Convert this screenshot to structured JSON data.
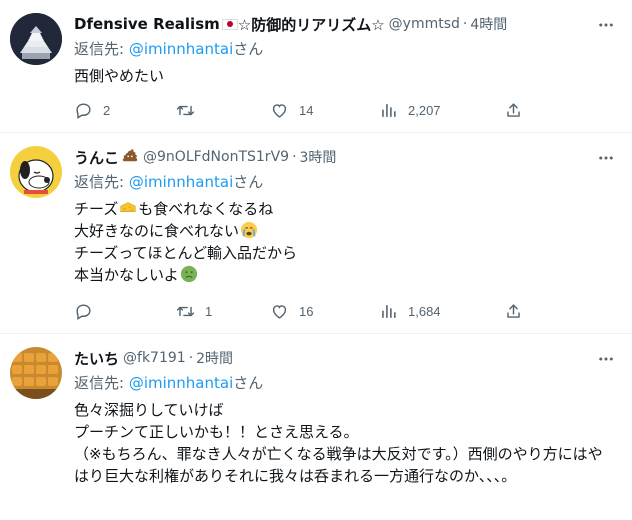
{
  "tweets": [
    {
      "display_name": "Dfensive Realism",
      "display_name_suffix": "☆防御的リアリズム☆",
      "handle": "@ymmtsd",
      "time": "4時間",
      "reply_prefix": "返信先: ",
      "reply_to": "@iminnhantai",
      "reply_suffix": "さん",
      "lines": [
        "西側やめたい"
      ],
      "counts": {
        "replies": "2",
        "retweets": "",
        "likes": "14",
        "views": "2,207"
      }
    },
    {
      "display_name": "うんこ",
      "handle": "@9nOLFdNonTS1rV9",
      "time": "3時間",
      "reply_prefix": "返信先: ",
      "reply_to": "@iminnhantai",
      "reply_suffix": "さん",
      "line1_a": "チーズ",
      "line1_b": "も食べれなくなるね",
      "line2": "大好きなのに食べれない",
      "line3": "チーズってほとんど輸入品だから",
      "line4": "本当かなしいよ",
      "counts": {
        "replies": "",
        "retweets": "1",
        "likes": "16",
        "views": "1,684"
      }
    },
    {
      "display_name": "たいち",
      "handle": "@fk7191",
      "time": "2時間",
      "reply_prefix": "返信先: ",
      "reply_to": "@iminnhantai",
      "reply_suffix": "さん",
      "lines": [
        "色々深掘りしていけば",
        "プーチンて正しいかも！！とさえ思える。",
        "（※もちろん、罪なき人々が亡くなる戦争は大反対です。）西側のやり方にはやはり巨大な利権がありそれに我々は呑まれる一方通行なのか、、、。"
      ]
    }
  ],
  "icons": [
    "reply-icon",
    "retweet-icon",
    "like-icon",
    "views-icon",
    "share-icon",
    "more-icon"
  ],
  "colors": {
    "text": "#0f1419",
    "muted": "#536471",
    "link": "#1d9bf0",
    "border": "#eff3f4"
  }
}
